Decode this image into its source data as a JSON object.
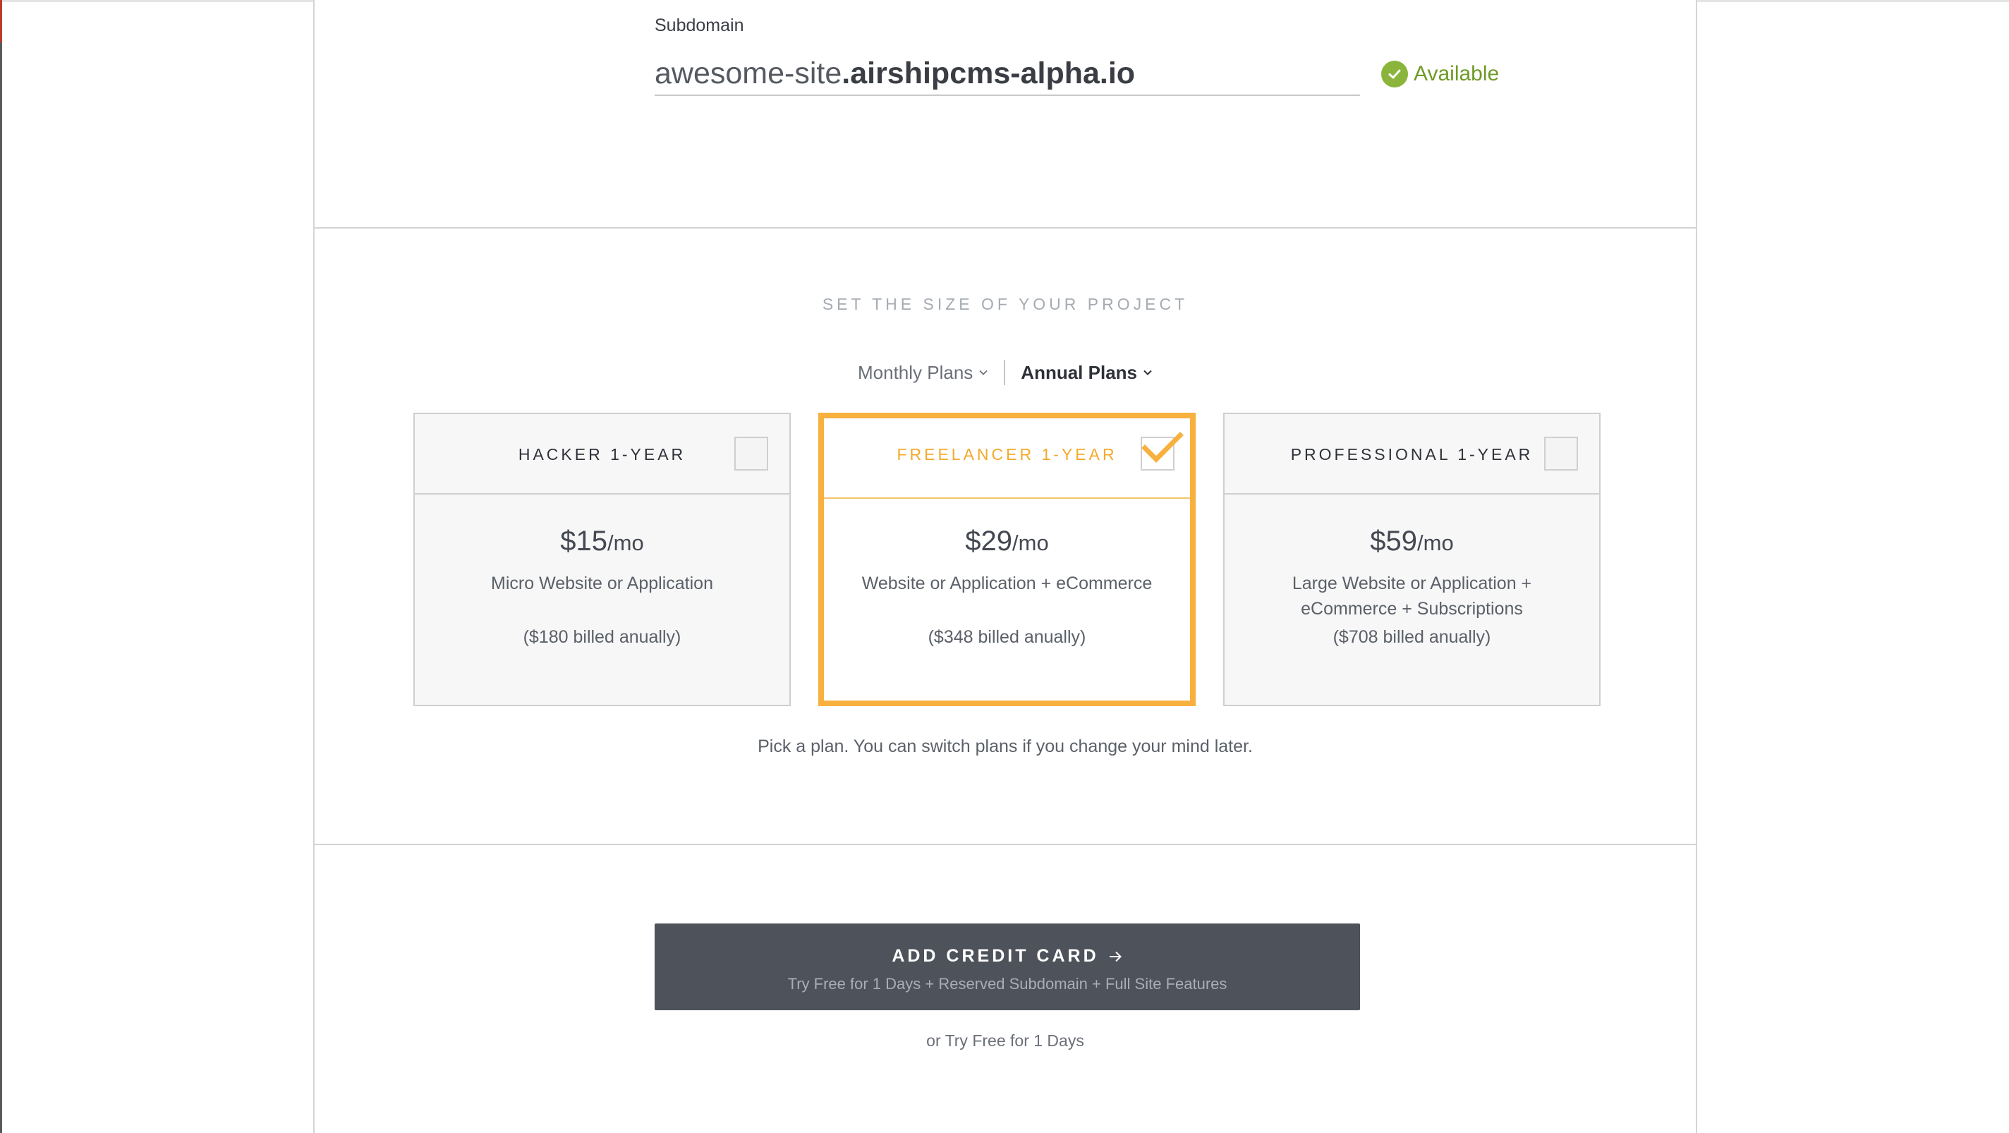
{
  "subdomain": {
    "label": "Subdomain",
    "value_prefix": "awesome-site",
    "value_suffix": ".airshipcms-alpha.io",
    "status": "Available",
    "status_color": "#8ab53a"
  },
  "plans_section": {
    "title": "SET THE SIZE OF YOUR PROJECT",
    "toggle": {
      "monthly_label": "Monthly Plans",
      "annual_label": "Annual Plans",
      "active": "annual"
    },
    "plans": [
      {
        "name": "HACKER 1-YEAR",
        "price": "$15",
        "per": "/mo",
        "description": "Micro Website or Application",
        "billed": "($180 billed anually)",
        "selected": false
      },
      {
        "name": "FREELANCER 1-YEAR",
        "price": "$29",
        "per": "/mo",
        "description": "Website or Application + eCommerce",
        "billed": "($348 billed anually)",
        "selected": true
      },
      {
        "name": "PROFESSIONAL 1-YEAR",
        "price": "$59",
        "per": "/mo",
        "description": "Large Website or Application + eCommerce + Subscriptions",
        "billed": "($708 billed anually)",
        "selected": false
      }
    ],
    "hint": "Pick a plan. You can switch plans if you change your mind later.",
    "accent_color": "#f8b13f"
  },
  "cta": {
    "label": "ADD CREDIT CARD",
    "sublabel": "Try Free for 1 Days + Reserved Subdomain + Full Site Features",
    "icon": "arrow-right-icon"
  },
  "trial_link": "or Try Free for 1 Days"
}
